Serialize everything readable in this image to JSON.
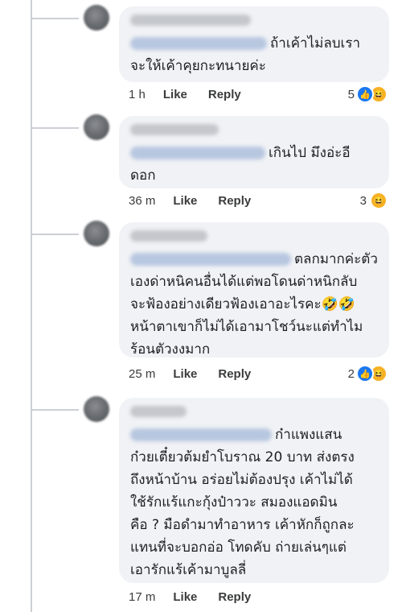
{
  "comments": [
    {
      "text_line1": "ถ้าเค้าไม่ลบเรา",
      "text_rest": "จะให้เค้าคุยกะทนายค่ะ",
      "time": "1 h",
      "like_label": "Like",
      "reply_label": "Reply",
      "reaction_count": "5",
      "reactions": [
        "like-icon",
        "haha-icon"
      ]
    },
    {
      "text_line1": "เกินไป มึงอ่ะอี",
      "text_rest": "ดอก",
      "time": "36 m",
      "like_label": "Like",
      "reply_label": "Reply",
      "reaction_count": "3",
      "reactions": [
        "haha-icon"
      ]
    },
    {
      "text_line1": "ตลกมากค่ะตัว",
      "text_rest": "เองด่าหนิคนอื่นได้แต่พอโดนด่าหนิกลับ\nจะฟ้องอย่างเดียวฟ้องเอาอะไรคะ🤣🤣\nหน้าตาเขาก็ไม่ได้เอามาโชว์นะแต่ทำไม\nร้อนตัวงงมาก",
      "time": "25 m",
      "like_label": "Like",
      "reply_label": "Reply",
      "reaction_count": "2",
      "reactions": [
        "like-icon",
        "haha-icon"
      ]
    },
    {
      "text_line1": "ก๋าแพงแสน",
      "text_rest": "ก๋วยเตี๋ยวต้มยำโบราณ 20 บาท ส่งตรง\nถึงหน้าบ้าน อร่อยไม่ต้องปรุง เค้าไม่ได้\nใช้รักแร้แกะกุ้งป๋าววะ สมองแอดมิน\nคือ ? มือดำมาทำอาหาร เค้าหักก็ถูกละ\nแทนที่จะบอกอ่อ โทดคับ ถ่ายเล่นๆแต่\nเอารักแร้เค้ามาบูลลี่",
      "time": "17 m",
      "like_label": "Like",
      "reply_label": "Reply",
      "reaction_count": "",
      "reactions": []
    }
  ],
  "colors": {
    "bubble": "#f0f2f5",
    "like": "#1877f2",
    "haha": "#f7b125"
  }
}
